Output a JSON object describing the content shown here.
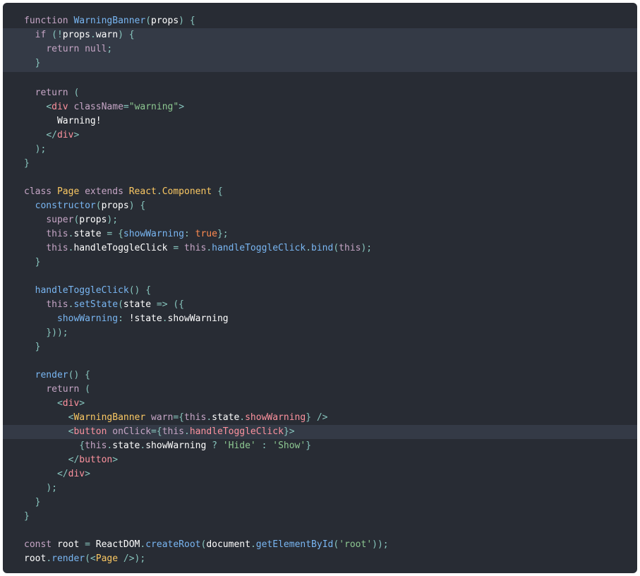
{
  "code": {
    "language": "jsx",
    "highlighted_lines": [
      2,
      3,
      4,
      30
    ],
    "lines": [
      [
        [
          "kw",
          "function "
        ],
        [
          "fn",
          "WarningBanner"
        ],
        [
          "punc",
          "("
        ],
        [
          "plain",
          "props"
        ],
        [
          "punc",
          ") {"
        ]
      ],
      [
        [
          "plain",
          "  "
        ],
        [
          "kw",
          "if "
        ],
        [
          "punc",
          "(!"
        ],
        [
          "plain",
          "props"
        ],
        [
          "punc",
          "."
        ],
        [
          "plain",
          "warn"
        ],
        [
          "punc",
          ") {"
        ]
      ],
      [
        [
          "plain",
          "    "
        ],
        [
          "kw",
          "return "
        ],
        [
          "kw",
          "null"
        ],
        [
          "punc",
          ";"
        ]
      ],
      [
        [
          "plain",
          "  "
        ],
        [
          "punc",
          "}"
        ]
      ],
      [],
      [
        [
          "plain",
          "  "
        ],
        [
          "kw",
          "return "
        ],
        [
          "punc",
          "("
        ]
      ],
      [
        [
          "plain",
          "    "
        ],
        [
          "punc",
          "<"
        ],
        [
          "tag",
          "div "
        ],
        [
          "attr",
          "className"
        ],
        [
          "punc",
          "="
        ],
        [
          "str",
          "\"warning\""
        ],
        [
          "punc",
          ">"
        ]
      ],
      [
        [
          "plain",
          "      Warning!"
        ]
      ],
      [
        [
          "plain",
          "    "
        ],
        [
          "punc",
          "</"
        ],
        [
          "tag",
          "div"
        ],
        [
          "punc",
          ">"
        ]
      ],
      [
        [
          "plain",
          "  "
        ],
        [
          "punc",
          ");"
        ]
      ],
      [
        [
          "punc",
          "}"
        ]
      ],
      [],
      [
        [
          "kw",
          "class "
        ],
        [
          "class",
          "Page "
        ],
        [
          "kw",
          "extends "
        ],
        [
          "class",
          "React"
        ],
        [
          "punc",
          "."
        ],
        [
          "class",
          "Component "
        ],
        [
          "punc",
          "{"
        ]
      ],
      [
        [
          "plain",
          "  "
        ],
        [
          "fn",
          "constructor"
        ],
        [
          "punc",
          "("
        ],
        [
          "plain",
          "props"
        ],
        [
          "punc",
          ") {"
        ]
      ],
      [
        [
          "plain",
          "    "
        ],
        [
          "kw",
          "super"
        ],
        [
          "punc",
          "("
        ],
        [
          "plain",
          "props"
        ],
        [
          "punc",
          ");"
        ]
      ],
      [
        [
          "plain",
          "    "
        ],
        [
          "this",
          "this"
        ],
        [
          "punc",
          "."
        ],
        [
          "plain",
          "state "
        ],
        [
          "punc",
          "= {"
        ],
        [
          "prop",
          "showWarning"
        ],
        [
          "punc",
          ": "
        ],
        [
          "bool",
          "true"
        ],
        [
          "punc",
          "};"
        ]
      ],
      [
        [
          "plain",
          "    "
        ],
        [
          "this",
          "this"
        ],
        [
          "punc",
          "."
        ],
        [
          "plain",
          "handleToggleClick "
        ],
        [
          "punc",
          "= "
        ],
        [
          "this",
          "this"
        ],
        [
          "punc",
          "."
        ],
        [
          "fn",
          "handleToggleClick"
        ],
        [
          "punc",
          "."
        ],
        [
          "fn",
          "bind"
        ],
        [
          "punc",
          "("
        ],
        [
          "this",
          "this"
        ],
        [
          "punc",
          ");"
        ]
      ],
      [
        [
          "plain",
          "  "
        ],
        [
          "punc",
          "}"
        ]
      ],
      [],
      [
        [
          "plain",
          "  "
        ],
        [
          "fn",
          "handleToggleClick"
        ],
        [
          "punc",
          "() {"
        ]
      ],
      [
        [
          "plain",
          "    "
        ],
        [
          "this",
          "this"
        ],
        [
          "punc",
          "."
        ],
        [
          "fn",
          "setState"
        ],
        [
          "punc",
          "("
        ],
        [
          "plain",
          "state "
        ],
        [
          "punc",
          "=> ({"
        ]
      ],
      [
        [
          "plain",
          "      "
        ],
        [
          "prop",
          "showWarning"
        ],
        [
          "punc",
          ": "
        ],
        [
          "plain",
          "!state"
        ],
        [
          "punc",
          "."
        ],
        [
          "plain",
          "showWarning"
        ]
      ],
      [
        [
          "plain",
          "    "
        ],
        [
          "punc",
          "}));"
        ]
      ],
      [
        [
          "plain",
          "  "
        ],
        [
          "punc",
          "}"
        ]
      ],
      [],
      [
        [
          "plain",
          "  "
        ],
        [
          "fn",
          "render"
        ],
        [
          "punc",
          "() {"
        ]
      ],
      [
        [
          "plain",
          "    "
        ],
        [
          "kw",
          "return "
        ],
        [
          "punc",
          "("
        ]
      ],
      [
        [
          "plain",
          "      "
        ],
        [
          "punc",
          "<"
        ],
        [
          "tag",
          "div"
        ],
        [
          "punc",
          ">"
        ]
      ],
      [
        [
          "plain",
          "        "
        ],
        [
          "punc",
          "<"
        ],
        [
          "class",
          "WarningBanner "
        ],
        [
          "attr",
          "warn"
        ],
        [
          "punc",
          "={"
        ],
        [
          "this",
          "this"
        ],
        [
          "punc",
          "."
        ],
        [
          "plain",
          "state"
        ],
        [
          "punc",
          "."
        ],
        [
          "tag",
          "showWarning"
        ],
        [
          "punc",
          "} />"
        ]
      ],
      [
        [
          "plain",
          "        "
        ],
        [
          "punc",
          "<"
        ],
        [
          "tag",
          "button "
        ],
        [
          "attr",
          "onClick"
        ],
        [
          "punc",
          "={"
        ],
        [
          "this",
          "this"
        ],
        [
          "punc",
          "."
        ],
        [
          "tag",
          "handleToggleClick"
        ],
        [
          "punc",
          "}>"
        ]
      ],
      [
        [
          "plain",
          "          "
        ],
        [
          "punc",
          "{"
        ],
        [
          "this",
          "this"
        ],
        [
          "punc",
          "."
        ],
        [
          "plain",
          "state"
        ],
        [
          "punc",
          "."
        ],
        [
          "plain",
          "showWarning "
        ],
        [
          "punc",
          "? "
        ],
        [
          "str",
          "'Hide' "
        ],
        [
          "punc",
          ": "
        ],
        [
          "str",
          "'Show'"
        ],
        [
          "punc",
          "}"
        ]
      ],
      [
        [
          "plain",
          "        "
        ],
        [
          "punc",
          "</"
        ],
        [
          "tag",
          "button"
        ],
        [
          "punc",
          ">"
        ]
      ],
      [
        [
          "plain",
          "      "
        ],
        [
          "punc",
          "</"
        ],
        [
          "tag",
          "div"
        ],
        [
          "punc",
          ">"
        ]
      ],
      [
        [
          "plain",
          "    "
        ],
        [
          "punc",
          ");"
        ]
      ],
      [
        [
          "plain",
          "  "
        ],
        [
          "punc",
          "}"
        ]
      ],
      [
        [
          "punc",
          "}"
        ]
      ],
      [],
      [
        [
          "kw",
          "const "
        ],
        [
          "plain",
          "root "
        ],
        [
          "punc",
          "= "
        ],
        [
          "plain",
          "ReactDOM"
        ],
        [
          "punc",
          "."
        ],
        [
          "fn",
          "createRoot"
        ],
        [
          "punc",
          "("
        ],
        [
          "plain",
          "document"
        ],
        [
          "punc",
          "."
        ],
        [
          "fn",
          "getElementById"
        ],
        [
          "punc",
          "("
        ],
        [
          "str",
          "'root'"
        ],
        [
          "punc",
          "));"
        ]
      ],
      [
        [
          "plain",
          "root"
        ],
        [
          "punc",
          "."
        ],
        [
          "fn",
          "render"
        ],
        [
          "punc",
          "(<"
        ],
        [
          "class",
          "Page "
        ],
        [
          "punc",
          "/>);"
        ]
      ]
    ]
  }
}
